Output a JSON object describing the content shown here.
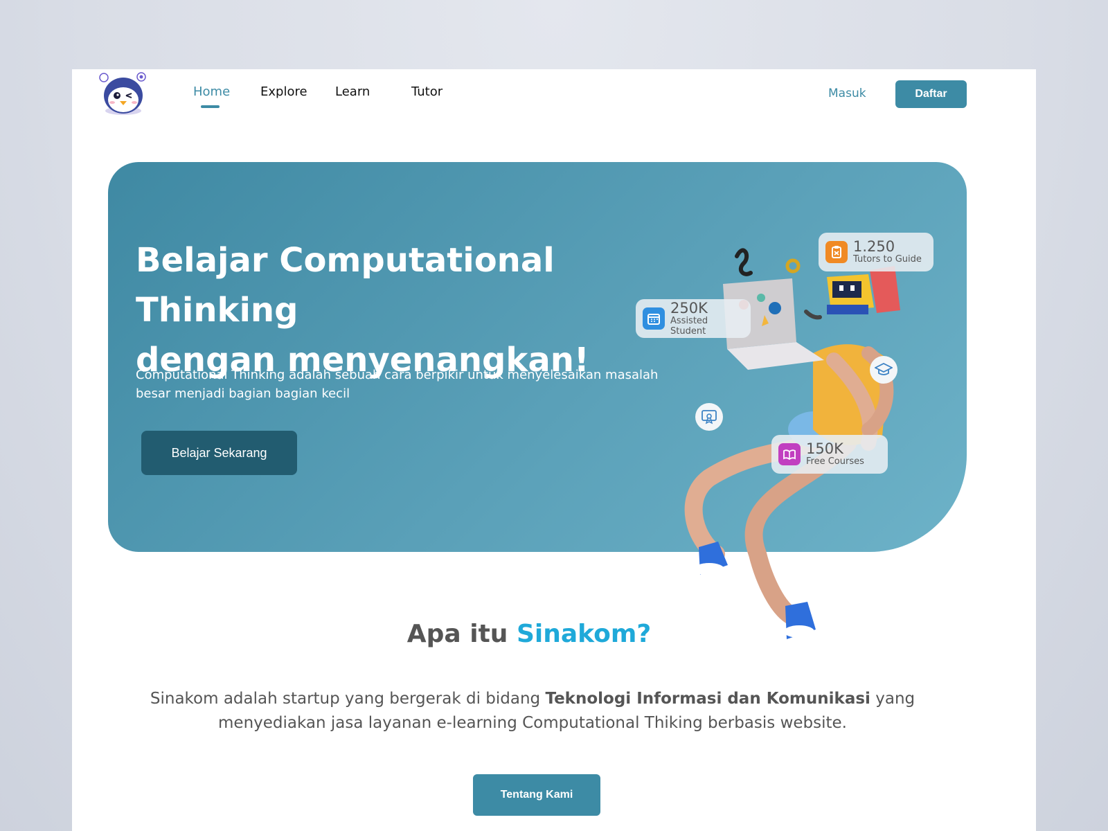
{
  "nav": {
    "links": [
      {
        "label": "Home",
        "active": true
      },
      {
        "label": "Explore",
        "active": false
      },
      {
        "label": "Learn",
        "active": false
      },
      {
        "label": "Tutor",
        "active": false
      }
    ],
    "login_label": "Masuk",
    "register_label": "Daftar"
  },
  "hero": {
    "title": "Belajar  Computational Thinking\ndengan menyenangkan!",
    "description": "Computational Thinking adalah sebuah cara berpikir untuk menyelesaikan masalah besar menjadi bagian bagian kecil",
    "cta_label": "Belajar Sekarang",
    "stats": [
      {
        "value": "1.250",
        "label": "Tutors to Guide",
        "icon": "clipboard-icon",
        "color": "#f08a24"
      },
      {
        "value": "250K",
        "label": "Assisted Student",
        "icon": "calendar-icon",
        "color": "#2f8fe0"
      },
      {
        "value": "150K",
        "label": "Free Courses",
        "icon": "book-icon",
        "color": "#c13fc0"
      }
    ],
    "floating_icons": [
      "graduation-cap-icon",
      "certificate-icon"
    ]
  },
  "about": {
    "title_prefix": "Apa itu ",
    "title_accent": "Sinakom?",
    "desc_before": "Sinakom adalah startup yang bergerak di bidang ",
    "desc_bold": "Teknologi Informasi dan Komunikasi",
    "desc_after": " yang menyediakan jasa layanan e-learning Computational Thiking berbasis website.",
    "cta_label": "Tentang Kami"
  },
  "colors": {
    "primary": "#3d8ba5",
    "hero_dark_button": "#225c70",
    "accent_blue": "#1fa9d9",
    "text_gray": "#555555"
  }
}
